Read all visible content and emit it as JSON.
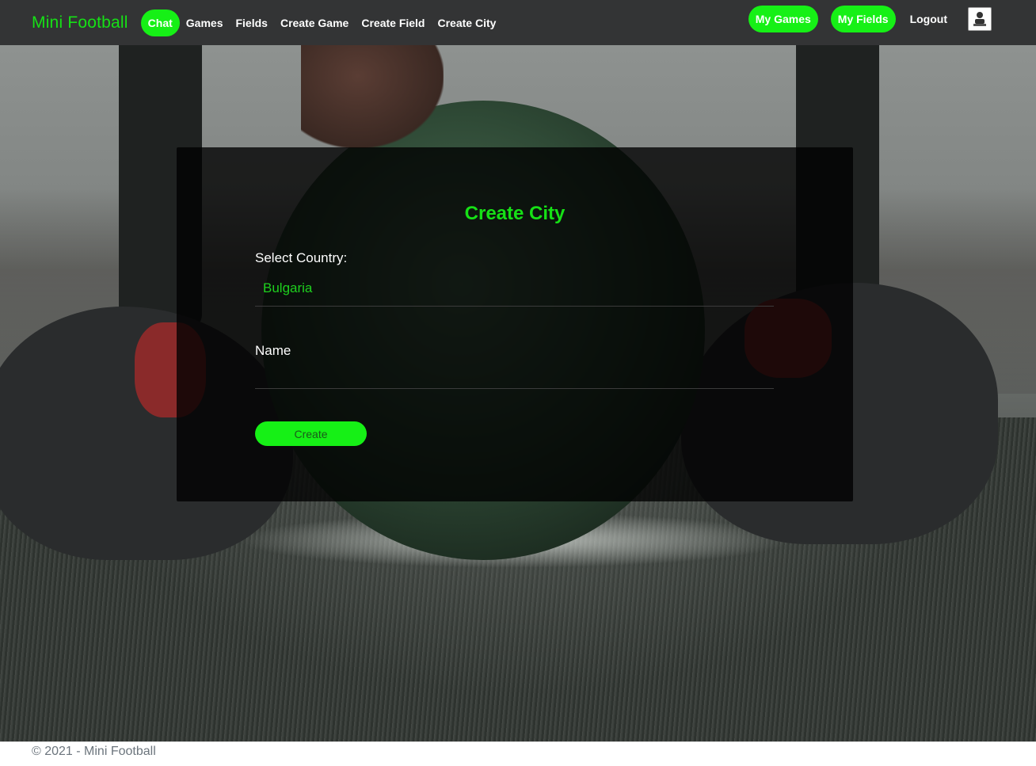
{
  "navbar": {
    "brand": "Mini Football",
    "links": [
      {
        "label": "Chat"
      },
      {
        "label": "Games"
      },
      {
        "label": "Fields"
      },
      {
        "label": "Create Game"
      },
      {
        "label": "Create Field"
      },
      {
        "label": "Create City"
      }
    ],
    "right": {
      "my_games": "My Games",
      "my_fields": "My Fields",
      "logout": "Logout",
      "avatar_icon": "user-avatar-icon"
    }
  },
  "form": {
    "title": "Create City",
    "country_label": "Select Country:",
    "country_value": "Bulgaria",
    "name_label": "Name",
    "name_value": "",
    "submit_label": "Create"
  },
  "footer": {
    "text": "© 2021 - Mini Football"
  },
  "colors": {
    "accent": "#16f016",
    "navbar_bg": "#333435",
    "card_bg": "#000000"
  }
}
